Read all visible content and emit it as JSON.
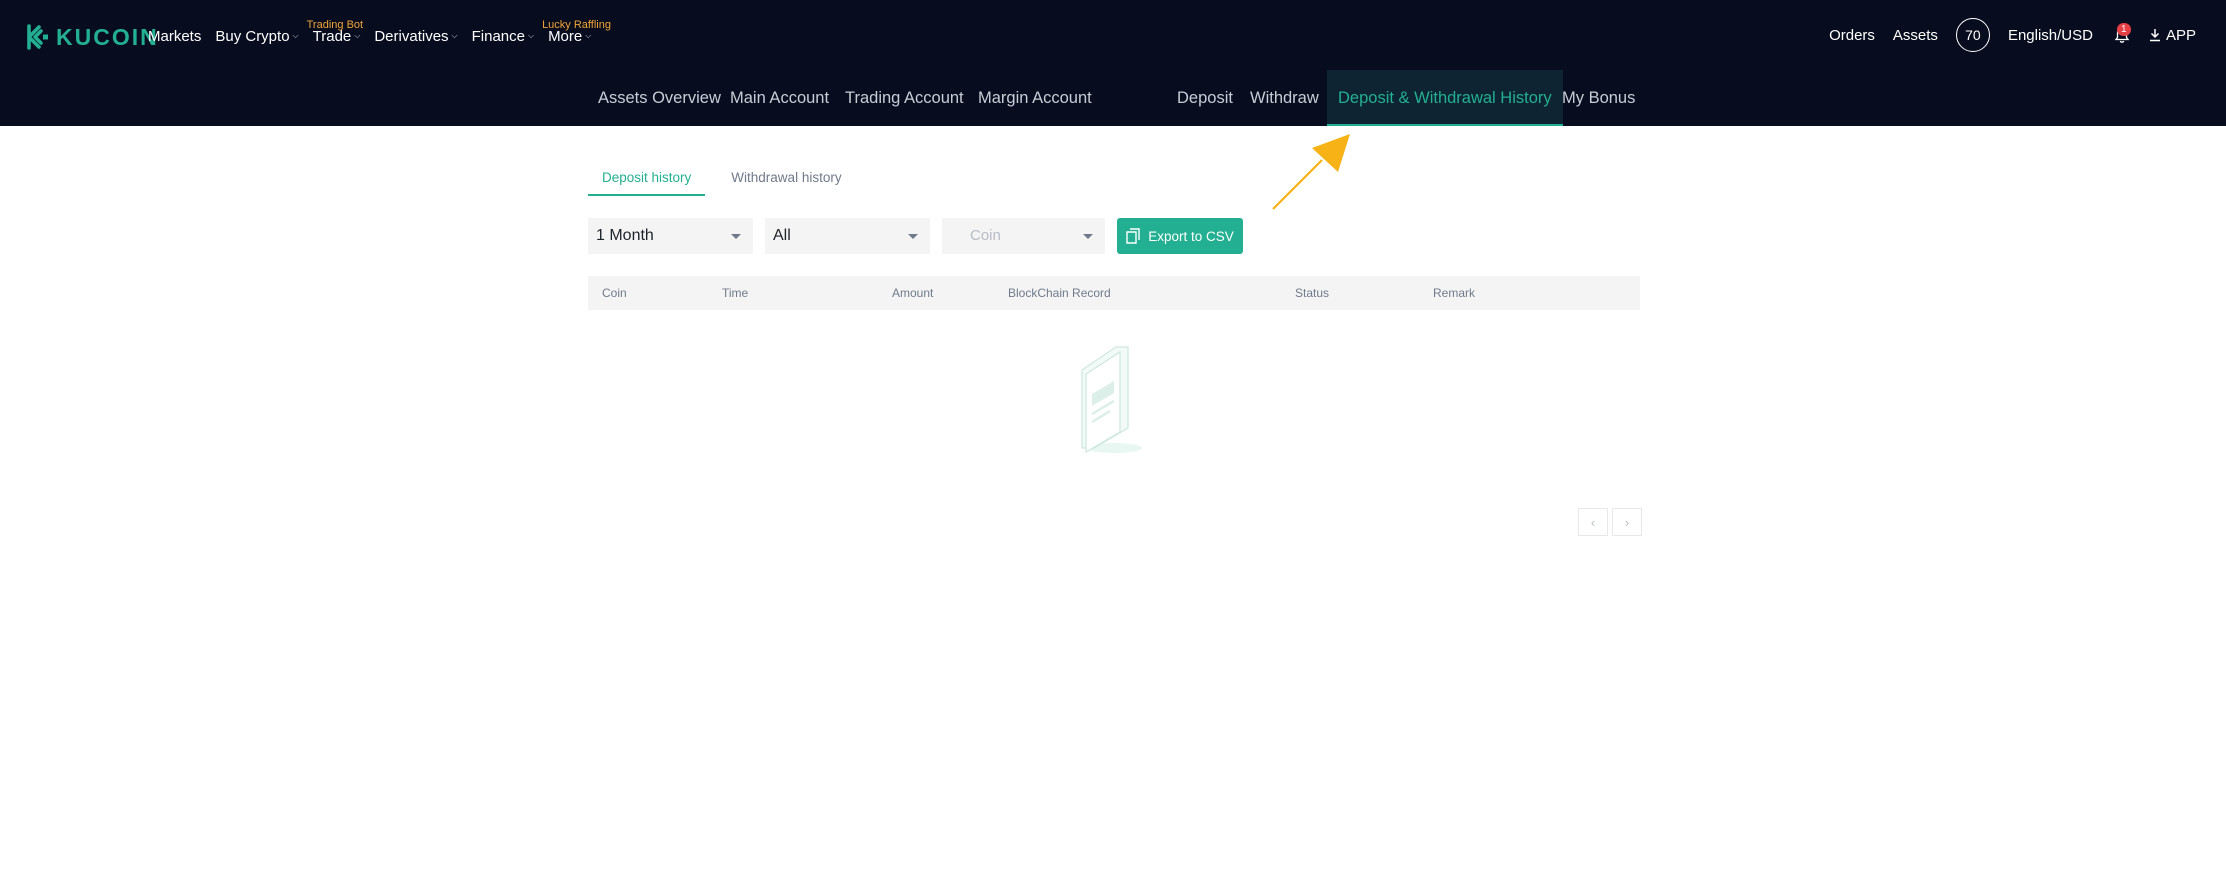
{
  "header": {
    "brand": "KUCOIN",
    "nav": [
      {
        "label": "Markets",
        "has_caret": false,
        "badge": ""
      },
      {
        "label": "Buy Crypto",
        "has_caret": true,
        "badge": ""
      },
      {
        "label": "Trade",
        "has_caret": true,
        "badge": "Trading Bot"
      },
      {
        "label": "Derivatives",
        "has_caret": true,
        "badge": ""
      },
      {
        "label": "Finance",
        "has_caret": true,
        "badge": ""
      },
      {
        "label": "More",
        "has_caret": true,
        "badge": "Lucky Raffling"
      }
    ],
    "orders": "Orders",
    "assets": "Assets",
    "avatar_text": "70",
    "language": "English/USD",
    "notification_count": "1",
    "app": "APP"
  },
  "subnav": {
    "assets_overview": "Assets Overview",
    "main_account": "Main Account",
    "trading_account": "Trading Account",
    "margin_account": "Margin Account",
    "deposit": "Deposit",
    "withdraw": "Withdraw",
    "history": "Deposit & Withdrawal History",
    "bonus": "My Bonus"
  },
  "tabs": {
    "deposit_history": "Deposit history",
    "withdrawal_history": "Withdrawal history"
  },
  "filters": {
    "period": "1 Month",
    "type": "All",
    "coin_placeholder": "Coin",
    "export": "Export to CSV"
  },
  "table": {
    "columns": [
      "Coin",
      "Time",
      "Amount",
      "BlockChain Record",
      "Status",
      "Remark"
    ]
  },
  "pagination": {
    "prev": "‹",
    "next": "›"
  },
  "colors": {
    "header_bg": "#070d1f",
    "accent": "#23af91",
    "badge": "#f2a435",
    "annotation_arrow": "#f7b316"
  }
}
